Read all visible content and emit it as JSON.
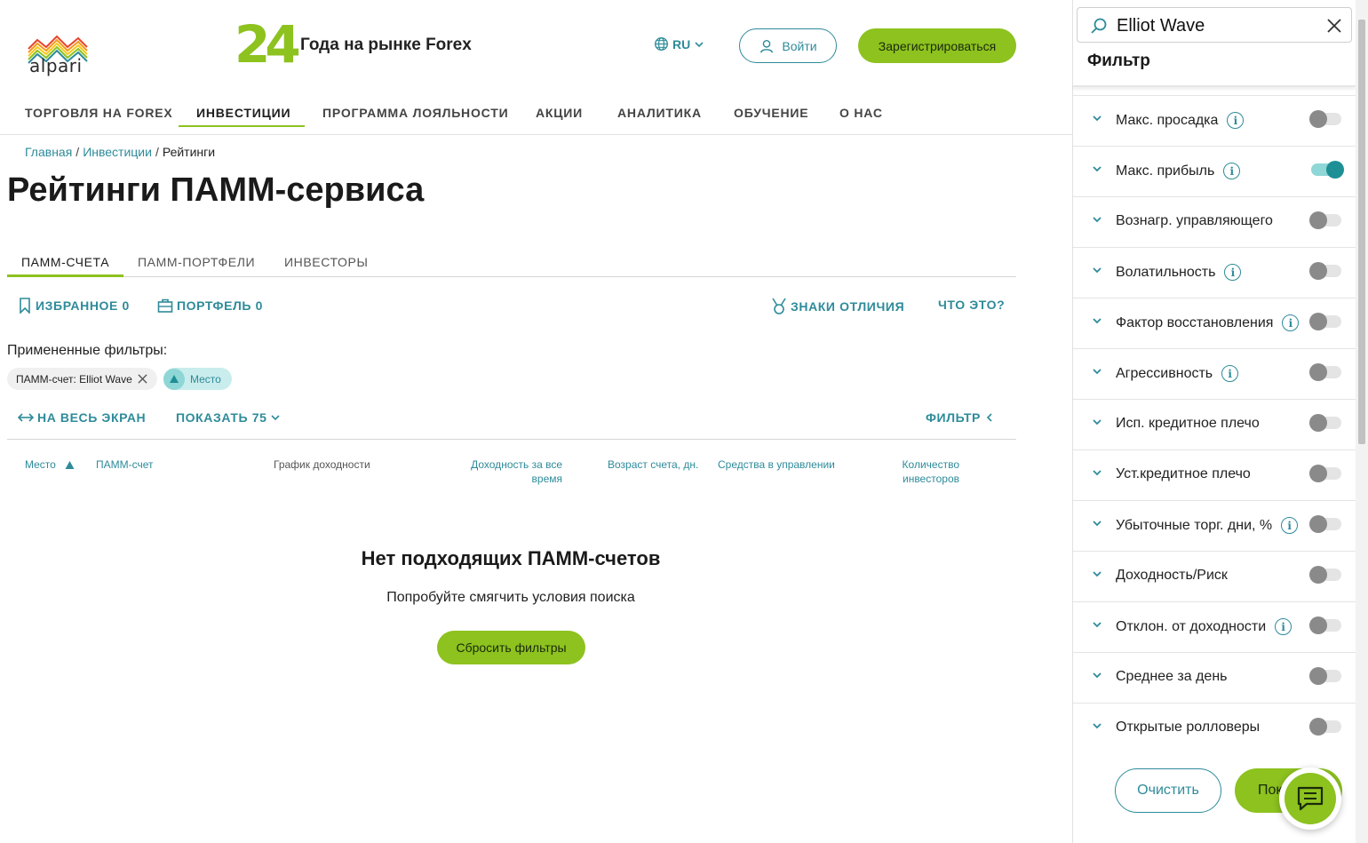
{
  "header": {
    "logo_text": "alpari",
    "anniv_number": "24",
    "anniv_text": "Года на рынке Forex",
    "lang": "RU",
    "login_label": "Войти",
    "register_label": "Зарегистрироваться"
  },
  "nav": {
    "items": [
      "ТОРГОВЛЯ НА FOREX",
      "ИНВЕСТИЦИИ",
      "ПРОГРАММА ЛОЯЛЬНОСТИ",
      "АКЦИИ",
      "АНАЛИТИКА",
      "ОБУЧЕНИЕ",
      "О НАС"
    ],
    "active": "ИНВЕСТИЦИИ"
  },
  "breadcrumb": {
    "home": "Главная",
    "sep": "/",
    "section": "Инвестиции",
    "current": "Рейтинги"
  },
  "page_title": "Рейтинги ПАММ-сервиса",
  "tabs": [
    "ПАММ-СЧЕТА",
    "ПАММ-ПОРТФЕЛИ",
    "ИНВЕСТОРЫ"
  ],
  "toolbar": {
    "favorites": "ИЗБРАННОЕ 0",
    "portfolio": "ПОРТФЕЛЬ 0",
    "badges": "ЗНАКИ ОТЛИЧИЯ",
    "what": "ЧТО ЭТО?"
  },
  "filters_applied": {
    "label": "Примененные фильтры:",
    "chip_account": "ПАММ-счет: Elliot Wave",
    "chip_sort": "Место"
  },
  "controls": {
    "fullscreen": "НА ВЕСЬ ЭКРАН",
    "show": "ПОКАЗАТЬ 75",
    "filter": "ФИЛЬТР"
  },
  "table": {
    "col_place": "Место",
    "col_account": "ПАММ-счет",
    "col_chart": "График доходности",
    "col_return_1": "Доходность за все",
    "col_return_2": "время",
    "col_age": "Возраст счета, дн.",
    "col_funds": "Средства в управлении",
    "col_investors_1": "Количество",
    "col_investors_2": "инвесторов"
  },
  "empty": {
    "title": "Нет подходящих ПАММ-счетов",
    "subtitle": "Попробуйте смягчить условия поиска",
    "reset_label": "Сбросить фильтры"
  },
  "panel": {
    "search_value": "Elliot Wave",
    "title": "Фильтр",
    "filters": [
      {
        "label": "Макс. просадка",
        "info": true,
        "on": false
      },
      {
        "label": "Макс. прибыль",
        "info": true,
        "on": true
      },
      {
        "label": "Вознагр. управляющего",
        "info": false,
        "on": false
      },
      {
        "label": "Волатильность",
        "info": true,
        "on": false
      },
      {
        "label": "Фактор восстановления",
        "info": true,
        "on": false
      },
      {
        "label": "Агрессивность",
        "info": true,
        "on": false
      },
      {
        "label": "Исп. кредитное плечо",
        "info": false,
        "on": false
      },
      {
        "label": "Уст.кредитное плечо",
        "info": false,
        "on": false
      },
      {
        "label": "Убыточные торг. дни, %",
        "info": true,
        "on": false
      },
      {
        "label": "Доходность/Риск",
        "info": false,
        "on": false
      },
      {
        "label": "Отклон. от доходности",
        "info": true,
        "on": false
      },
      {
        "label": "Среднее за день",
        "info": false,
        "on": false
      },
      {
        "label": "Открытые ролловеры",
        "info": false,
        "on": false
      }
    ],
    "clear_label": "Очистить",
    "show_label": "Пок"
  },
  "colors": {
    "accent_green": "#8dc21f",
    "accent_teal": "#2e8b9a"
  }
}
